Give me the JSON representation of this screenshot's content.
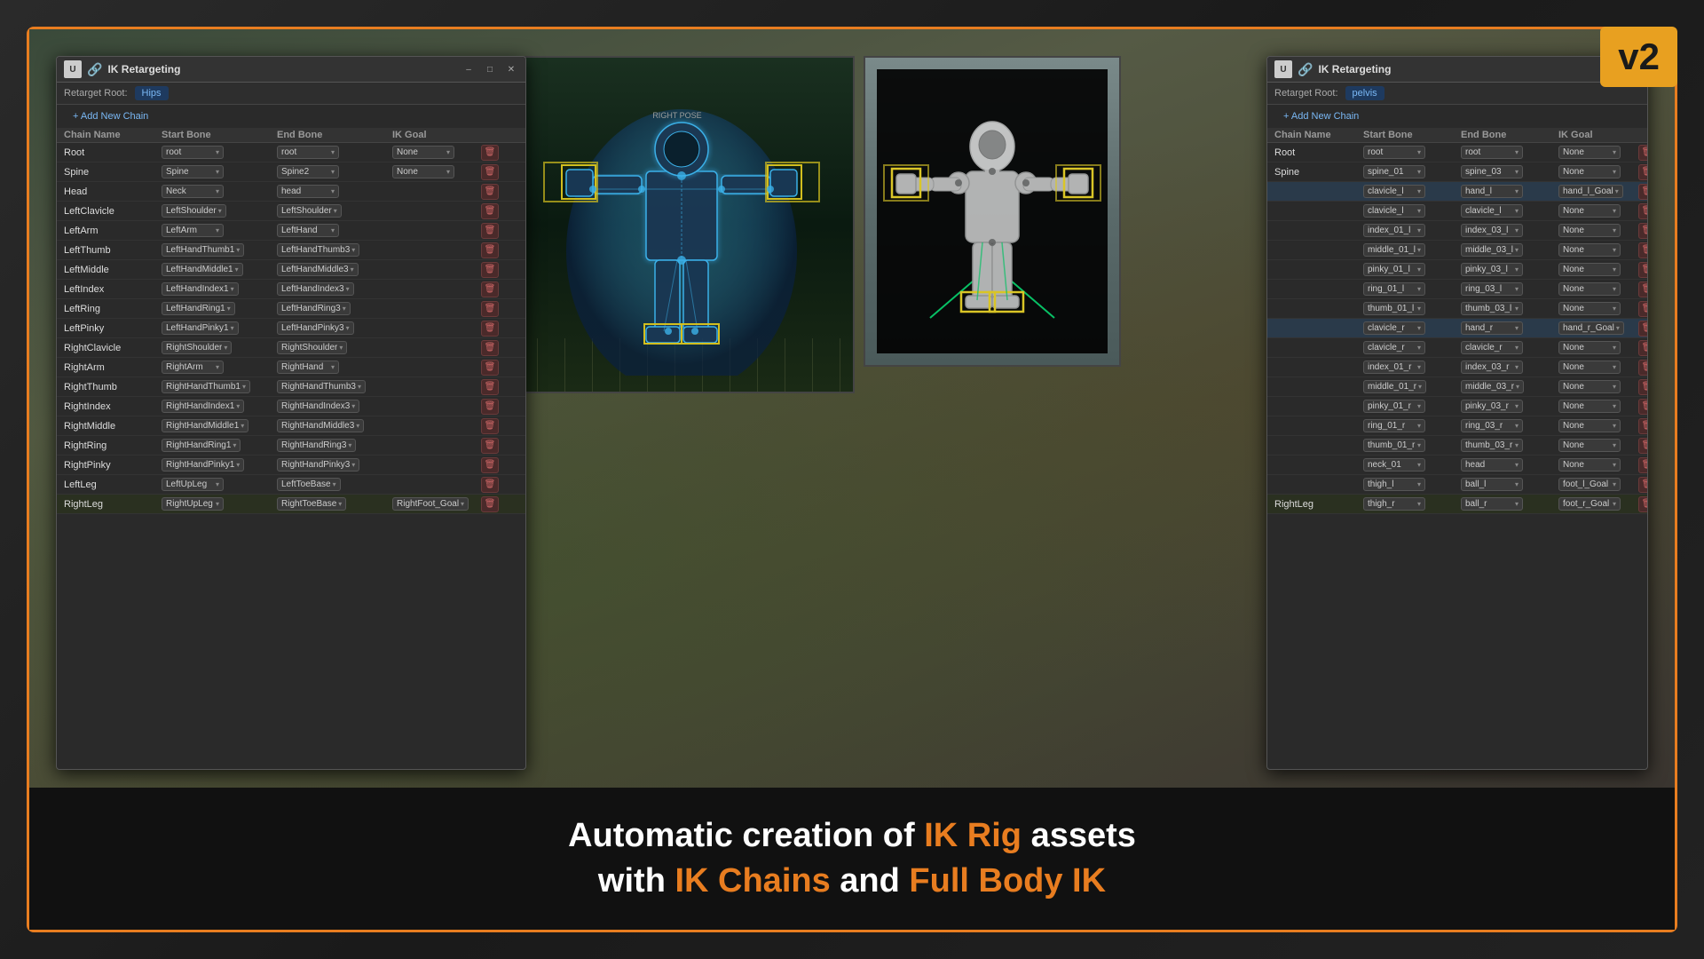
{
  "frame": {
    "v2_label": "v2"
  },
  "left_panel": {
    "title": "IK Retargeting",
    "retarget_root_label": "Retarget Root:",
    "retarget_root_value": "Hips",
    "add_chain_label": "+ Add New Chain",
    "columns": [
      "Chain Name",
      "Start Bone",
      "End Bone",
      "IK Goal",
      ""
    ],
    "rows": [
      {
        "name": "Root",
        "start": "root",
        "end": "root",
        "ik_goal": "None"
      },
      {
        "name": "Spine",
        "start": "Spine",
        "end": "Spine2",
        "ik_goal": "None"
      },
      {
        "name": "Head",
        "start": "Neck",
        "end": "head",
        "ik_goal": ""
      },
      {
        "name": "LeftClavicle",
        "start": "LeftShoulder",
        "end": "LeftShoulder",
        "ik_goal": ""
      },
      {
        "name": "LeftArm",
        "start": "LeftArm",
        "end": "LeftHand",
        "ik_goal": ""
      },
      {
        "name": "LeftThumb",
        "start": "LeftHandThumb1",
        "end": "LeftHandThumb3",
        "ik_goal": ""
      },
      {
        "name": "LeftMiddle",
        "start": "LeftHandMiddle1",
        "end": "LeftHandMiddle3",
        "ik_goal": ""
      },
      {
        "name": "LeftIndex",
        "start": "LeftHandIndex1",
        "end": "LeftHandIndex3",
        "ik_goal": ""
      },
      {
        "name": "LeftRing",
        "start": "LeftHandRing1",
        "end": "LeftHandRing3",
        "ik_goal": ""
      },
      {
        "name": "LeftPinky",
        "start": "LeftHandPinky1",
        "end": "LeftHandPinky3",
        "ik_goal": ""
      },
      {
        "name": "RightClavicle",
        "start": "RightShoulder",
        "end": "RightShoulder",
        "ik_goal": ""
      },
      {
        "name": "RightArm",
        "start": "RightArm",
        "end": "RightHand",
        "ik_goal": ""
      },
      {
        "name": "RightThumb",
        "start": "RightHandThumb1",
        "end": "RightHandThumb3",
        "ik_goal": ""
      },
      {
        "name": "RightIndex",
        "start": "RightHandIndex1",
        "end": "RightHandIndex3",
        "ik_goal": ""
      },
      {
        "name": "RightMiddle",
        "start": "RightHandMiddle1",
        "end": "RightHandMiddle3",
        "ik_goal": ""
      },
      {
        "name": "RightRing",
        "start": "RightHandRing1",
        "end": "RightHandRing3",
        "ik_goal": ""
      },
      {
        "name": "RightPinky",
        "start": "RightHandPinky1",
        "end": "RightHandPinky3",
        "ik_goal": ""
      },
      {
        "name": "LeftLeg",
        "start": "LeftUpLeg",
        "end": "LeftToeBase",
        "ik_goal": ""
      },
      {
        "name": "RightLeg",
        "start": "RightUpLeg",
        "end": "RightToeBase",
        "ik_goal": "RightFoot_Goal"
      }
    ]
  },
  "right_panel": {
    "title": "IK Retargeting",
    "retarget_root_label": "Retarget Root:",
    "retarget_root_value": "pelvis",
    "add_chain_label": "+ Add New Chain",
    "columns": [
      "Chain Name",
      "Start Bone",
      "End Bone",
      "IK Goal",
      ""
    ],
    "rows": [
      {
        "name": "Root",
        "start": "root",
        "end": "root",
        "ik_goal": "None"
      },
      {
        "name": "Spine",
        "start": "spine_01",
        "end": "spine_03",
        "ik_goal": "None"
      },
      {
        "name": "",
        "start": "clavicle_l",
        "end": "hand_l",
        "ik_goal": "hand_l_Goal"
      },
      {
        "name": "",
        "start": "clavicle_l",
        "end": "clavicle_l",
        "ik_goal": "None"
      },
      {
        "name": "",
        "start": "index_01_l",
        "end": "index_03_l",
        "ik_goal": "None"
      },
      {
        "name": "",
        "start": "middle_01_l",
        "end": "middle_03_l",
        "ik_goal": "None"
      },
      {
        "name": "",
        "start": "pinky_01_l",
        "end": "pinky_03_l",
        "ik_goal": "None"
      },
      {
        "name": "",
        "start": "ring_01_l",
        "end": "ring_03_l",
        "ik_goal": "None"
      },
      {
        "name": "",
        "start": "thumb_01_l",
        "end": "thumb_03_l",
        "ik_goal": "None"
      },
      {
        "name": "",
        "start": "clavicle_r",
        "end": "hand_r",
        "ik_goal": "hand_r_Goal"
      },
      {
        "name": "",
        "start": "clavicle_r",
        "end": "clavicle_r",
        "ik_goal": "None"
      },
      {
        "name": "",
        "start": "index_01_r",
        "end": "index_03_r",
        "ik_goal": "None"
      },
      {
        "name": "",
        "start": "middle_01_r",
        "end": "middle_03_r",
        "ik_goal": "None"
      },
      {
        "name": "",
        "start": "pinky_01_r",
        "end": "pinky_03_r",
        "ik_goal": "None"
      },
      {
        "name": "",
        "start": "ring_01_r",
        "end": "ring_03_r",
        "ik_goal": "None"
      },
      {
        "name": "",
        "start": "thumb_01_r",
        "end": "thumb_03_r",
        "ik_goal": "None"
      },
      {
        "name": "",
        "start": "neck_01",
        "end": "head",
        "ik_goal": "None"
      },
      {
        "name": "",
        "start": "thigh_l",
        "end": "ball_l",
        "ik_goal": "foot_l_Goal"
      },
      {
        "name": "RightLeg",
        "start": "thigh_r",
        "end": "ball_r",
        "ik_goal": "foot_r_Goal"
      }
    ]
  },
  "bottom_text": {
    "line1_plain": "Automatic creation of ",
    "line1_orange": "IK Rig",
    "line1_plain2": " assets",
    "line2_plain": "with ",
    "line2_orange1": "IK Chains",
    "line2_plain2": " and ",
    "line2_orange2": "Full Body IK"
  }
}
